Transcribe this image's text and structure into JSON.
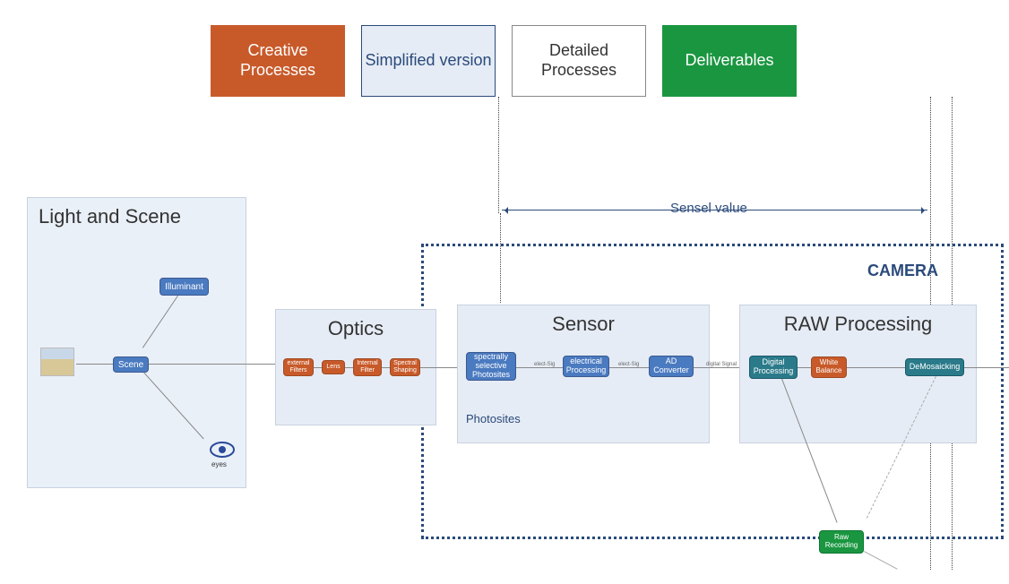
{
  "legend": {
    "creative": "Creative Processes",
    "simplified": "Simplified version",
    "detailed": "Detailed Processes",
    "deliverables": "Deliverables"
  },
  "panels": {
    "light": "Light and Scene",
    "optics": "Optics",
    "sensor": "Sensor",
    "raw": "RAW Processing"
  },
  "camera_label": "CAMERA",
  "sensel_label": "Sensel value",
  "lightScene": {
    "illuminant": "Illuminant",
    "scene": "Scene",
    "eyes": "eyes"
  },
  "optics": {
    "external_filters": "external Filters",
    "lens": "Lens",
    "internal_filter": "Internal Filter",
    "spectral_shaping": "Spectral Shaping"
  },
  "sensor": {
    "photosites": "spectrally selective Photosites",
    "electrical": "electrical Processing",
    "ad_converter": "AD Converter",
    "photosites_label": "Photosites"
  },
  "rawProcessing": {
    "digital": "Digital Processing",
    "white_balance": "White Balance",
    "demosaicking": "DeMosaicking"
  },
  "deliverables": {
    "raw_recording": "Raw Recording"
  },
  "flow": {
    "elect_sig": "elect-Sig",
    "digital_signal": "digital Signal"
  }
}
